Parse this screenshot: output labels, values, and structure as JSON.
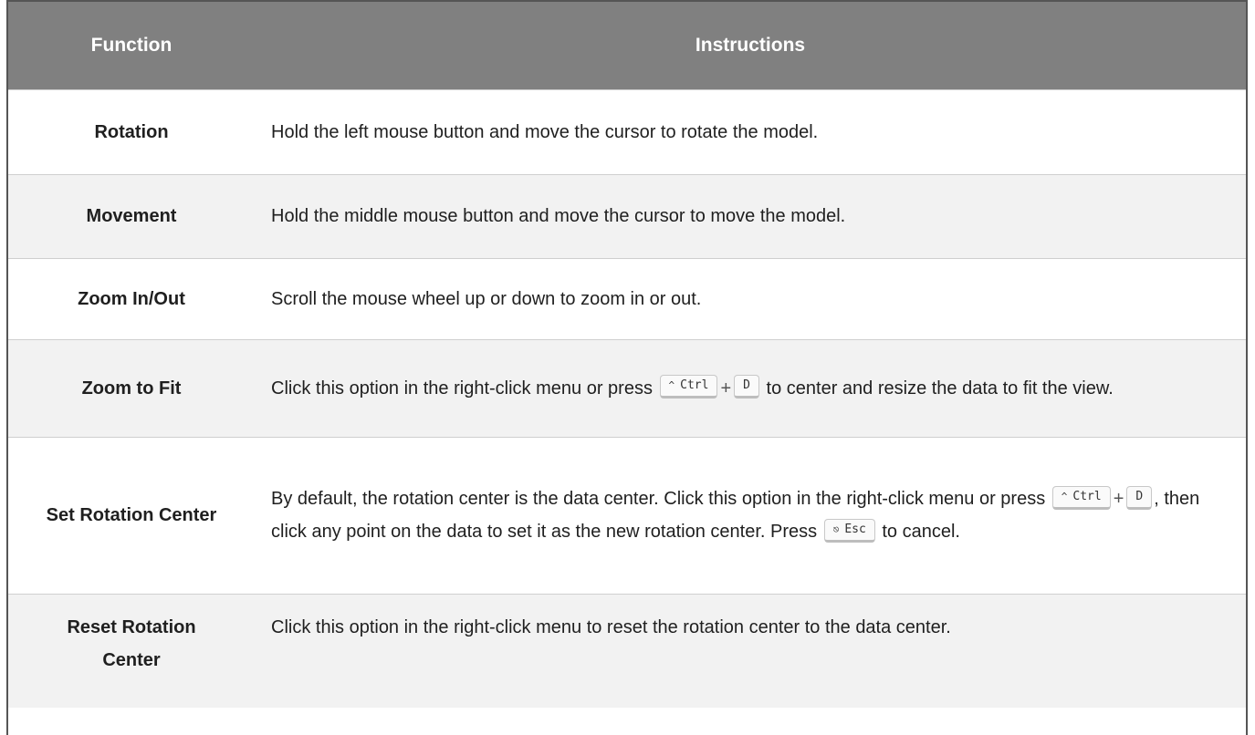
{
  "header": {
    "function": "Function",
    "instructions": "Instructions"
  },
  "rows": [
    {
      "function": "Rotation",
      "instructions": "Hold the left mouse button and move the cursor to rotate the model."
    },
    {
      "function": "Movement",
      "instructions": "Hold the middle mouse button and move the cursor to move the model."
    },
    {
      "function": "Zoom In/Out",
      "instructions": "Scroll the mouse wheel up or down to zoom in or out."
    },
    {
      "function": "Zoom to Fit",
      "text_before": "Click this option in the right-click menu or press",
      "key1_symbol": "^",
      "key1_label": "Ctrl",
      "plus": "+",
      "key2_label": "D",
      "text_after": "to center and resize the data to fit the view."
    },
    {
      "function": "Set Rotation Center",
      "text_before": "By default, the rotation center is the data center. Click this option in the right-click menu or press",
      "key1_symbol": "^",
      "key1_label": "Ctrl",
      "plus": "+",
      "key2_label": "D",
      "text_middle": ", then click any point on the data to set it as the new rotation center. Press",
      "key3_symbol": "⎋",
      "key3_label": "Esc",
      "text_after": "to cancel."
    },
    {
      "function": "Reset Rotation Center",
      "instructions": "Click this option in the right-click menu to reset the rotation center to the data center."
    }
  ]
}
